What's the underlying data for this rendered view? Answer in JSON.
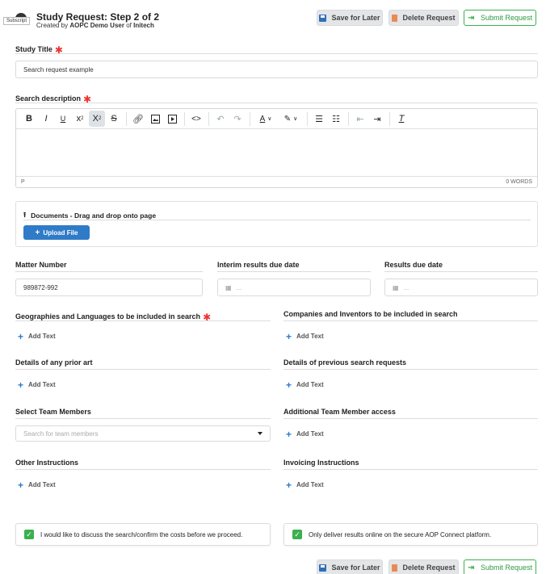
{
  "header": {
    "title": "Study Request: Step 2 of 2",
    "created_prefix": "Created by",
    "created_user": "AOPC Demo User",
    "created_of": "of",
    "created_org": "Initech",
    "tooltip": "Subscript"
  },
  "actions": {
    "save_label": "Save for Later",
    "delete_label": "Delete Request",
    "submit_label": "Submit Request"
  },
  "study_title": {
    "label": "Study Title",
    "value": "Search request example"
  },
  "description": {
    "label": "Search description",
    "status_path": "P",
    "word_count": "0 WORDS"
  },
  "documents": {
    "label": "Documents - Drag and drop onto page",
    "upload_label": "Upload File"
  },
  "matter": {
    "label": "Matter Number",
    "value": "989872-992"
  },
  "interim": {
    "label": "Interim results due date",
    "placeholder": "..."
  },
  "results": {
    "label": "Results due date",
    "placeholder": "..."
  },
  "fields": {
    "geographies": "Geographies and Languages to be included in search",
    "companies": "Companies and Inventors to be included in search",
    "prior_art": "Details of any prior art",
    "previous": "Details of previous search requests",
    "team_members": "Select Team Members",
    "additional_access": "Additional Team Member access",
    "other_instructions": "Other Instructions",
    "invoicing": "Invoicing Instructions",
    "add_text": "Add Text",
    "team_placeholder": "Search for team members"
  },
  "checks": {
    "discuss": "I would like to discuss the search/confirm the costs before we proceed.",
    "online": "Only deliver results online on the secure AOP Connect platform."
  },
  "colors": {
    "accent": "#2f7bc8",
    "success": "#3bb04f",
    "required": "#ee3333"
  }
}
